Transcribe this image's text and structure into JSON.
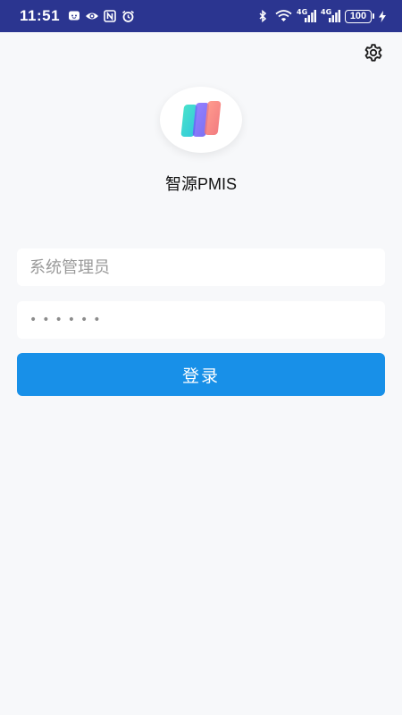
{
  "status_bar": {
    "time": "11:51",
    "network_1": "4G",
    "network_2": "4G",
    "battery": "100",
    "background_color": "#2b3590",
    "icons": [
      "message-icon",
      "eye-icon",
      "nfc-icon",
      "alarm-icon",
      "bluetooth-icon",
      "wifi-icon",
      "signal-icon",
      "signal-icon",
      "battery-icon",
      "charging-icon"
    ]
  },
  "header": {
    "settings_icon": "gear-icon"
  },
  "app": {
    "name": "智源PMIS"
  },
  "login_form": {
    "username_placeholder": "系统管理员",
    "password_placeholder": "••••••",
    "submit_label": "登录",
    "accent_color": "#1890e8"
  }
}
